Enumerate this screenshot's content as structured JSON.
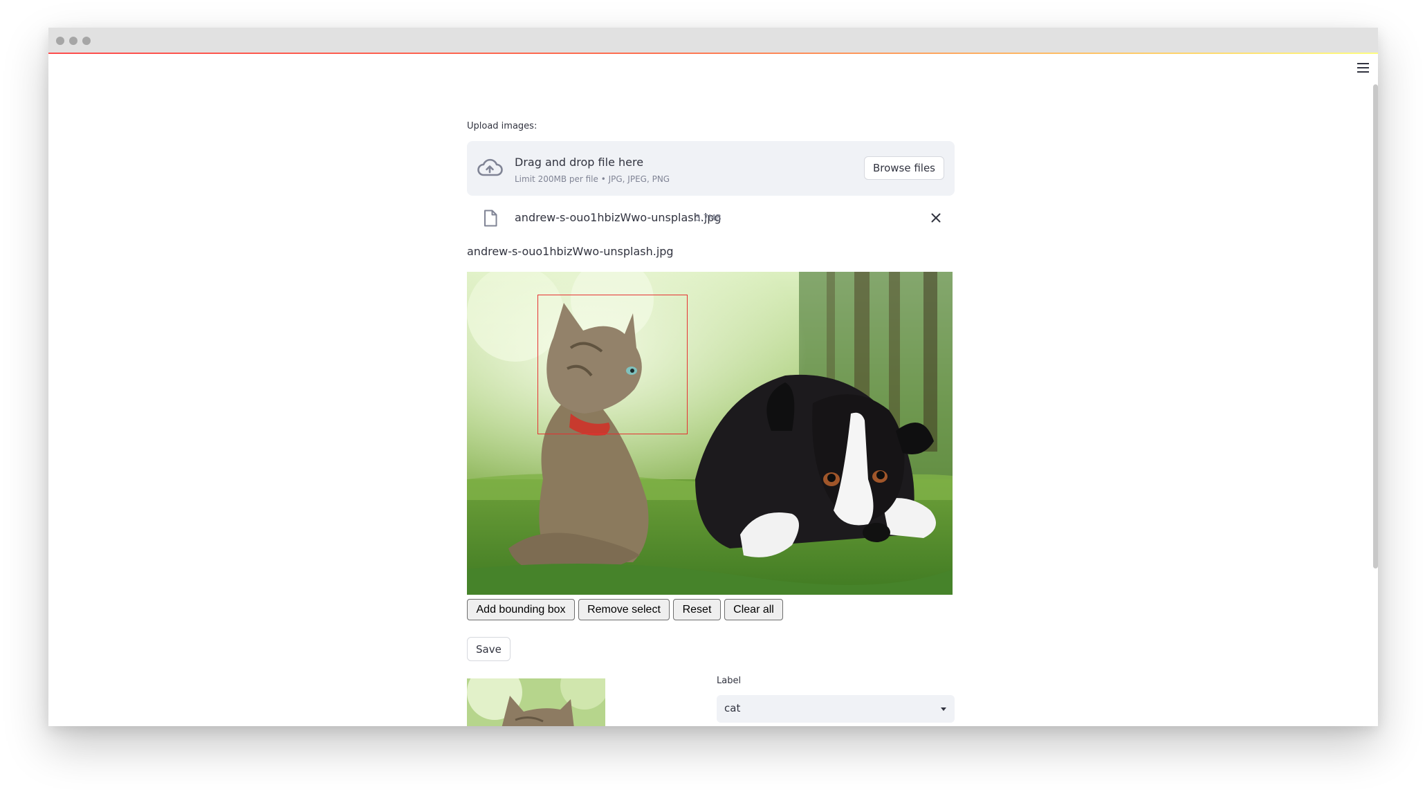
{
  "uploader": {
    "label": "Upload images:",
    "drop_text": "Drag and drop file here",
    "limit_text": "Limit 200MB per file • JPG, JPEG, PNG",
    "browse_label": "Browse files"
  },
  "file": {
    "name": "andrew-s-ouo1hbizWwo-unsplash.jpg",
    "size": "3.7MB"
  },
  "image_caption": "andrew-s-ouo1hbizWwo-unsplash.jpg",
  "annotation": {
    "box_color": "#e53030"
  },
  "toolbar": {
    "add_bbox": "Add bounding box",
    "remove_select": "Remove select",
    "reset": "Reset",
    "clear_all": "Clear all"
  },
  "save_label": "Save",
  "label_field": {
    "title": "Label",
    "value": "cat"
  },
  "colors": {
    "accent_red": "#ff4b4b",
    "panel_bg": "#f0f2f6",
    "text": "#31333f"
  }
}
